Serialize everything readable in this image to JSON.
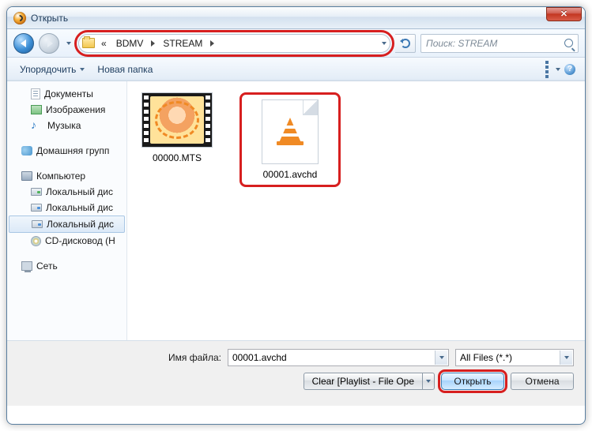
{
  "window": {
    "title": "Открыть"
  },
  "address": {
    "prefix": "«",
    "parts": [
      "BDMV",
      "STREAM"
    ]
  },
  "search": {
    "placeholder": "Поиск: STREAM"
  },
  "toolbar": {
    "organize": "Упорядочить",
    "newfolder": "Новая папка",
    "help_glyph": "?"
  },
  "tree": {
    "documents": "Документы",
    "images": "Изображения",
    "music": "Музыка",
    "homegroup": "Домашняя групп",
    "computer": "Компьютер",
    "drive1": "Локальный дис",
    "drive2": "Локальный дис",
    "drive3": "Локальный дис",
    "cd": "CD-дисковод (H",
    "network": "Сеть"
  },
  "files": {
    "f1": "00000.MTS",
    "f2": "00001.avchd"
  },
  "bottom": {
    "filename_label": "Имя файла:",
    "filename_value": "00001.avchd",
    "filetype_value": "All Files (*.*)",
    "clear_label": "Clear [Playlist - File Ope",
    "open": "Открыть",
    "cancel": "Отмена"
  }
}
